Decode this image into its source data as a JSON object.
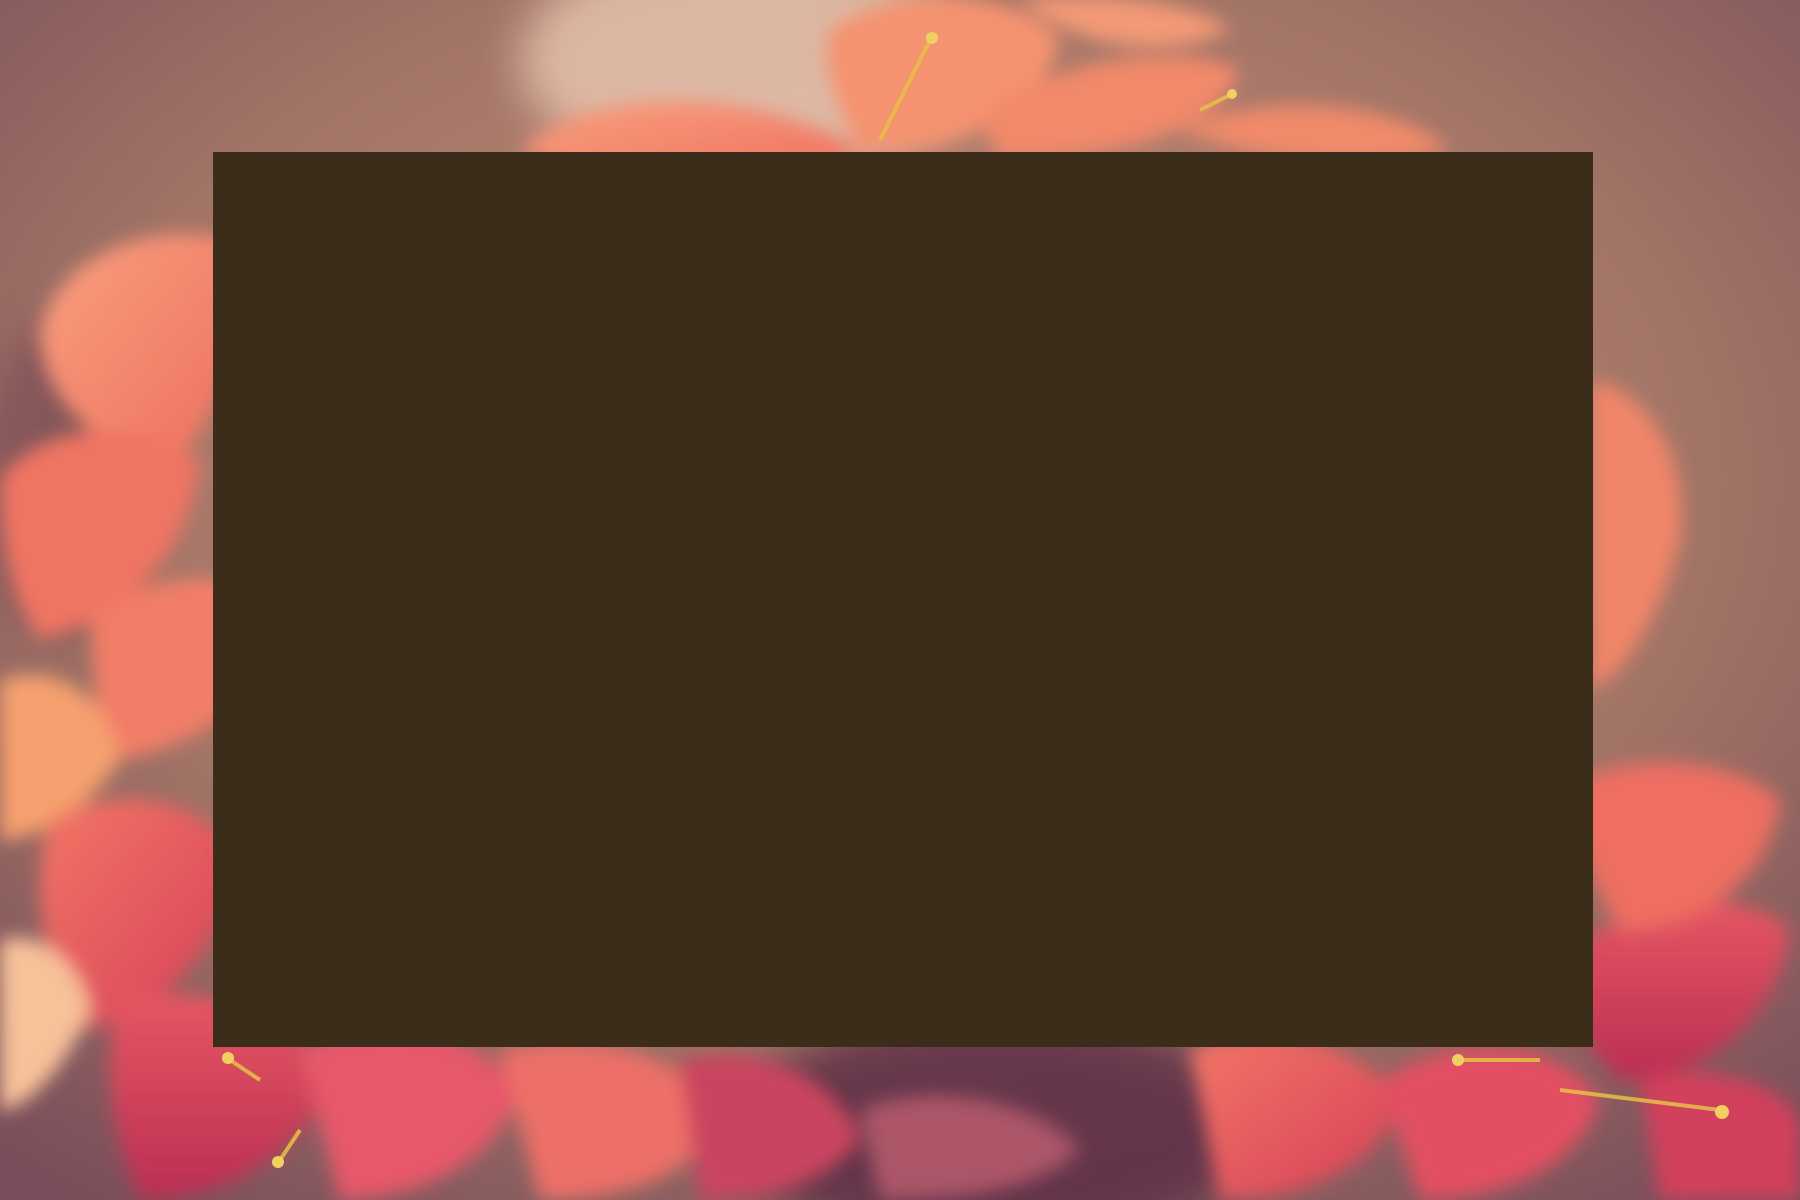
{
  "scene": {
    "subject": "flowers-photo",
    "panel_color": "#3B2D1A",
    "background_tone": "#A27466",
    "petal_colors": [
      "#F58C6E",
      "#EF6E5E",
      "#E04A5C",
      "#C93657"
    ],
    "stamen_color": "#E8C046",
    "shadow_color": "#5A2A44"
  }
}
